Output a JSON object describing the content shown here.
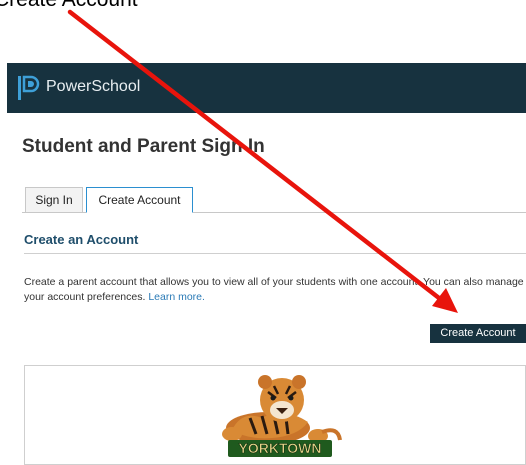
{
  "caption": "Create Account",
  "header": {
    "brand": "PowerSchool"
  },
  "page_title": "Student and Parent Sign In",
  "tabs": [
    {
      "label": "Sign In",
      "active": false
    },
    {
      "label": "Create Account",
      "active": true
    }
  ],
  "section": {
    "title": "Create an Account",
    "description": "Create a parent account that allows you to view all of your students with one account. You can also manage your account preferences.",
    "learn_more": "Learn more."
  },
  "create_button": "Create Account",
  "logo": {
    "text": "YORKTOWN"
  },
  "colors": {
    "header": "#17323f",
    "arrow": "#e8140c",
    "link": "#2a7ab6",
    "tab_active_border": "#2b8fd0"
  },
  "icons": [
    "powerschool-logo-icon",
    "tiger-mascot-icon"
  ]
}
